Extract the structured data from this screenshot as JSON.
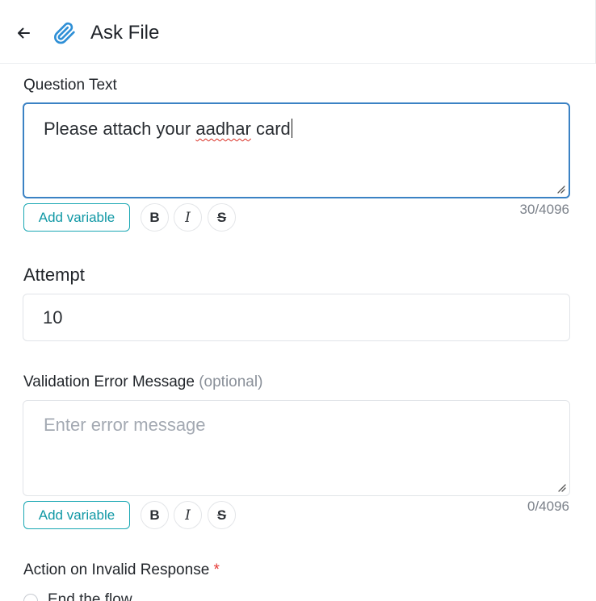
{
  "header": {
    "title": "Ask File",
    "back_icon": "arrow-left-icon",
    "title_icon": "paperclip-icon",
    "accent": "#2e8fd6"
  },
  "question": {
    "label": "Question Text",
    "value_pre": "Please attach your ",
    "value_misspelled": "aadhar",
    "value_post": " card",
    "counter": "30/4096"
  },
  "toolbar1": {
    "add_variable": "Add variable",
    "bold": "B",
    "italic": "I",
    "strike": "S"
  },
  "attempt": {
    "label": "Attempt",
    "value": "10"
  },
  "validation": {
    "label": "Validation Error Message",
    "optional": "(optional)",
    "placeholder": "Enter error message",
    "counter": "0/4096"
  },
  "toolbar2": {
    "add_variable": "Add variable",
    "bold": "B",
    "italic": "I",
    "strike": "S"
  },
  "action": {
    "label": "Action on Invalid Response",
    "required_mark": "*",
    "options": [
      "End the flow"
    ]
  }
}
